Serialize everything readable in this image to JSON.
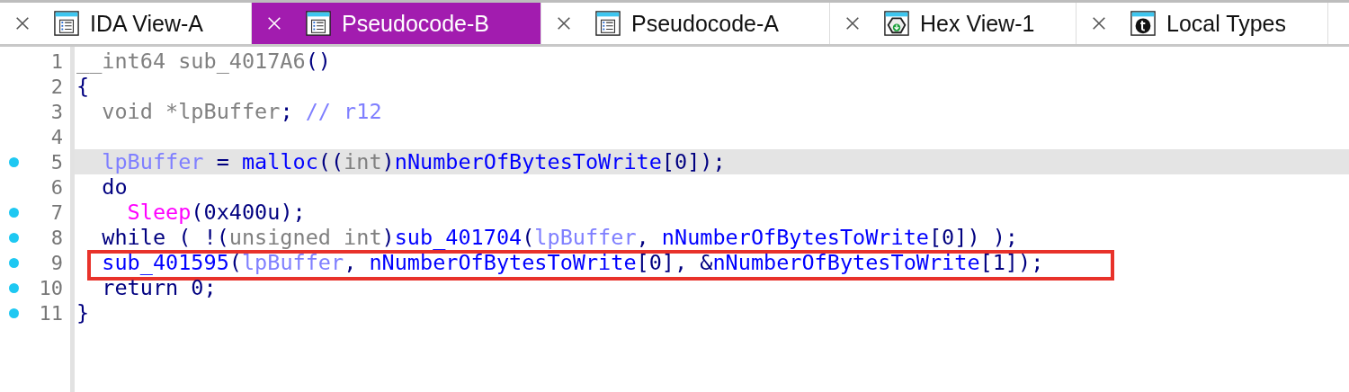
{
  "tabs": [
    {
      "label": "IDA View-A",
      "kind": "listing",
      "selected": false
    },
    {
      "label": "Pseudocode-B",
      "kind": "listing",
      "selected": true
    },
    {
      "label": "Pseudocode-A",
      "kind": "listing",
      "selected": false
    },
    {
      "label": "Hex View-1",
      "kind": "hex",
      "selected": false
    },
    {
      "label": "Local Types",
      "kind": "types",
      "selected": false
    }
  ],
  "code": {
    "lines": [
      {
        "number": "1",
        "breakpoint": false,
        "current": false,
        "boxed": false,
        "tokens": [
          {
            "kind": "keyword",
            "text": "__int64 sub_4017A6"
          },
          {
            "kind": "punct",
            "text": "()"
          }
        ]
      },
      {
        "number": "2",
        "breakpoint": false,
        "current": false,
        "boxed": false,
        "tokens": [
          {
            "kind": "punct",
            "text": "{"
          }
        ]
      },
      {
        "number": "3",
        "breakpoint": false,
        "current": false,
        "boxed": false,
        "tokens": [
          {
            "kind": "keyword",
            "text": "  void *lpBuffer"
          },
          {
            "kind": "punct",
            "text": ";"
          },
          {
            "kind": "comment",
            "text": " // r12"
          }
        ]
      },
      {
        "number": "4",
        "breakpoint": false,
        "current": false,
        "boxed": false
      },
      {
        "number": "5",
        "breakpoint": true,
        "current": true,
        "boxed": false,
        "tokens": [
          {
            "kind": "variable",
            "text": "  lpBuffer"
          },
          {
            "kind": "punct",
            "text": " = "
          },
          {
            "kind": "function",
            "text": "malloc"
          },
          {
            "kind": "punct",
            "text": "(("
          },
          {
            "kind": "keyword",
            "text": "int"
          },
          {
            "kind": "punct",
            "text": ")"
          },
          {
            "kind": "function",
            "text": "nNumberOfBytesToWrite"
          },
          {
            "kind": "punct",
            "text": "[0]);"
          }
        ]
      },
      {
        "number": "6",
        "breakpoint": false,
        "current": false,
        "boxed": false,
        "tokens": [
          {
            "kind": "punct",
            "text": "  do"
          }
        ]
      },
      {
        "number": "7",
        "breakpoint": true,
        "current": false,
        "boxed": false,
        "tokens": [
          {
            "kind": "library",
            "text": "    Sleep"
          },
          {
            "kind": "punct",
            "text": "(0x400u);"
          }
        ]
      },
      {
        "number": "8",
        "breakpoint": true,
        "current": false,
        "boxed": false,
        "tokens": [
          {
            "kind": "punct",
            "text": "  while ( !("
          },
          {
            "kind": "keyword",
            "text": "unsigned int"
          },
          {
            "kind": "punct",
            "text": ")"
          },
          {
            "kind": "function",
            "text": "sub_401704"
          },
          {
            "kind": "punct",
            "text": "("
          },
          {
            "kind": "variable",
            "text": "lpBuffer"
          },
          {
            "kind": "punct",
            "text": ", "
          },
          {
            "kind": "function",
            "text": "nNumberOfBytesToWrite"
          },
          {
            "kind": "punct",
            "text": "[0]) );"
          }
        ]
      },
      {
        "number": "9",
        "breakpoint": true,
        "current": false,
        "boxed": true,
        "tokens": [
          {
            "kind": "function",
            "text": "  sub_401595"
          },
          {
            "kind": "punct",
            "text": "("
          },
          {
            "kind": "variable",
            "text": "lpBuffer"
          },
          {
            "kind": "punct",
            "text": ", "
          },
          {
            "kind": "function",
            "text": "nNumberOfBytesToWrite"
          },
          {
            "kind": "punct",
            "text": "[0], &"
          },
          {
            "kind": "function",
            "text": "nNumberOfBytesToWrite"
          },
          {
            "kind": "punct",
            "text": "[1]);"
          }
        ]
      },
      {
        "number": "10",
        "breakpoint": true,
        "current": false,
        "boxed": false,
        "tokens": [
          {
            "kind": "punct",
            "text": "  return 0;"
          }
        ]
      },
      {
        "number": "11",
        "breakpoint": true,
        "current": false,
        "boxed": false,
        "tokens": [
          {
            "kind": "punct",
            "text": "}"
          }
        ]
      }
    ]
  }
}
